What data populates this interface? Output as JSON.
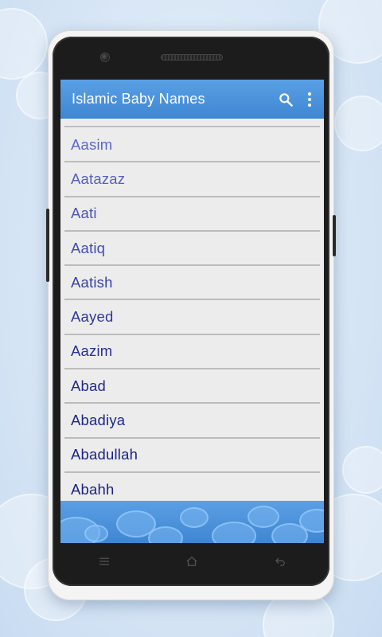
{
  "app": {
    "title": "Islamic Baby Names"
  },
  "toolbar": {
    "search_icon": "search-icon",
    "overflow_icon": "overflow-menu-icon"
  },
  "names": [
    "Aasim",
    "Aatazaz",
    "Aati",
    "Aatiq",
    "Aatish",
    "Aayed",
    "Aazim",
    "Abad",
    "Abadiya",
    "Abadullah",
    "Abahh"
  ],
  "colors": {
    "appbar": "#4a90d9",
    "name_text_start": "#5b66c6",
    "name_text_end": "#1a237e",
    "list_bg": "#ececec",
    "divider": "#bcbcbc"
  },
  "navigation": {
    "menu_icon": "menu-lines-icon",
    "home_icon": "home-icon",
    "back_icon": "back-arrow-icon"
  }
}
